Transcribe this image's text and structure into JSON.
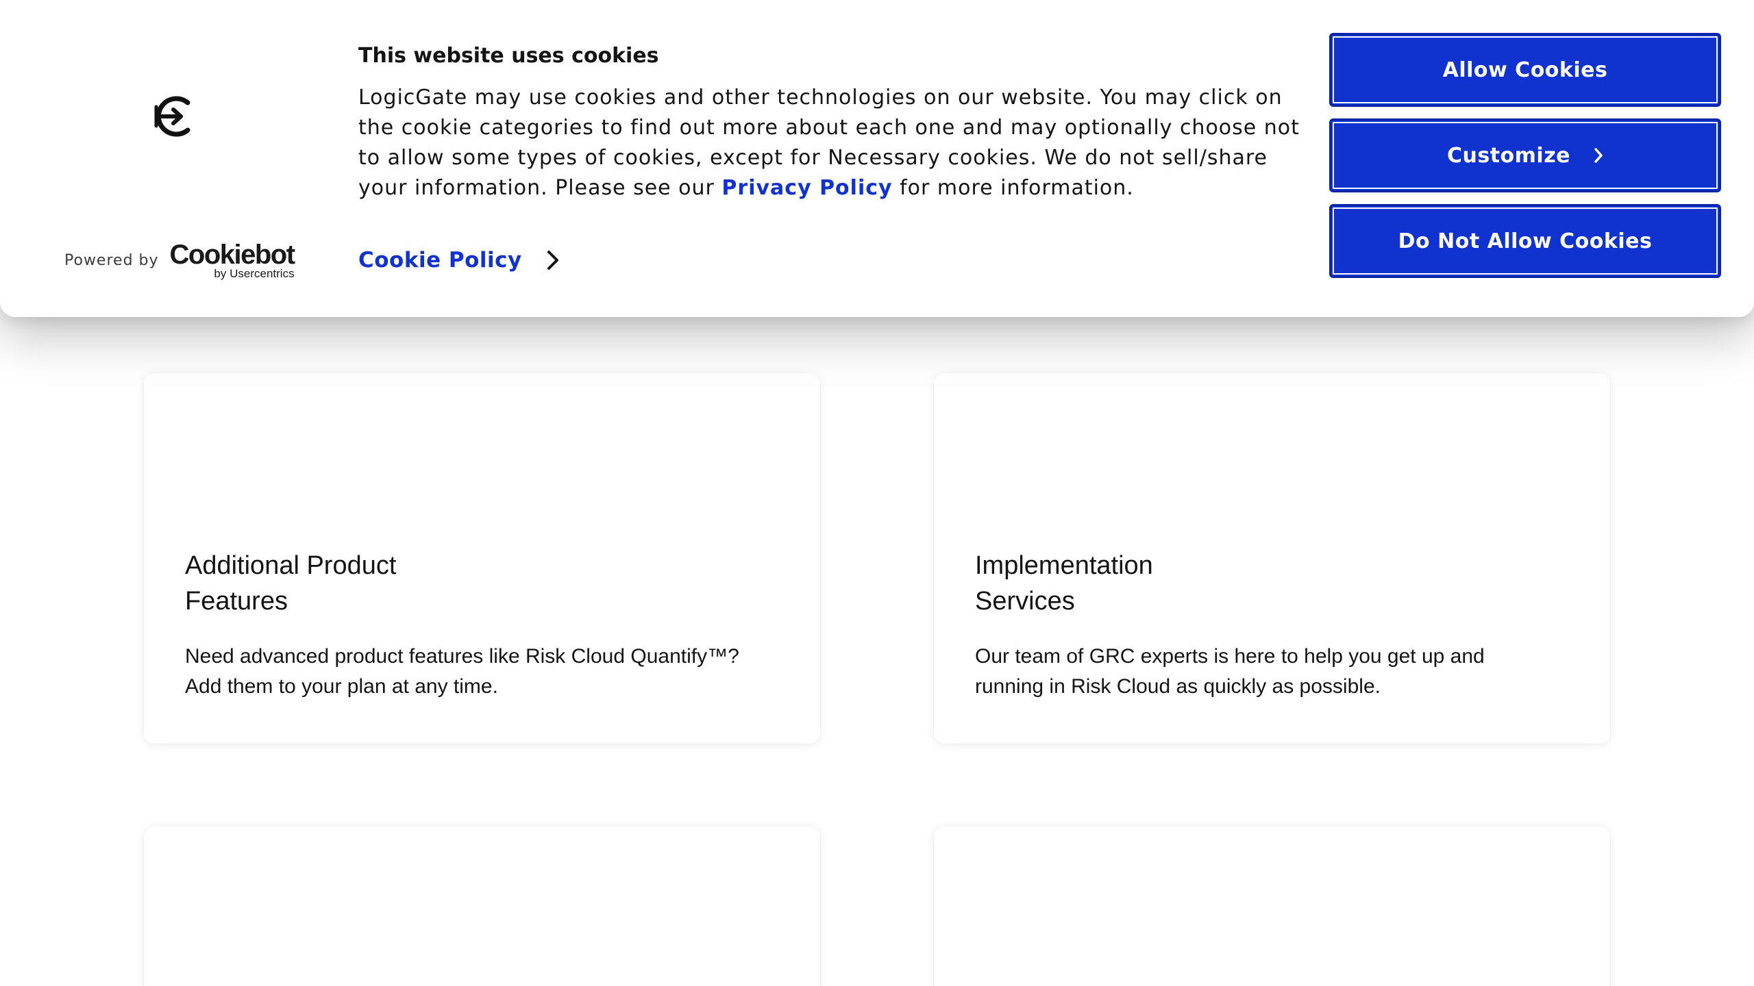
{
  "cookie_banner": {
    "title": "This website uses cookies",
    "text_before_link": "LogicGate may use cookies and other technologies on our website. You may click on the cookie categories to find out more about each one and may optionally choose not to allow some types of cookies, except for Necessary cookies.  We do not sell/share your information. Please see our ",
    "privacy_link": "Privacy Policy",
    "text_after_link": " for more information.",
    "cookie_policy_link": "Cookie Policy",
    "powered_by": "Powered by",
    "cookiebot_name": "Cookiebot",
    "cookiebot_byline": "by Usercentrics",
    "buttons": {
      "allow": "Allow Cookies",
      "customize": "Customize",
      "deny": "Do Not Allow Cookies"
    },
    "accent_color": "#1032cf"
  },
  "cards": [
    {
      "title": "Additional Product\nFeatures",
      "text": "Need advanced product features like Risk Cloud Quantify™?\nAdd them to your plan at any time."
    },
    {
      "title": "Implementation\nServices",
      "text": "Our team of GRC experts is here to help you get up and\nrunning in Risk Cloud as quickly as possible."
    }
  ]
}
